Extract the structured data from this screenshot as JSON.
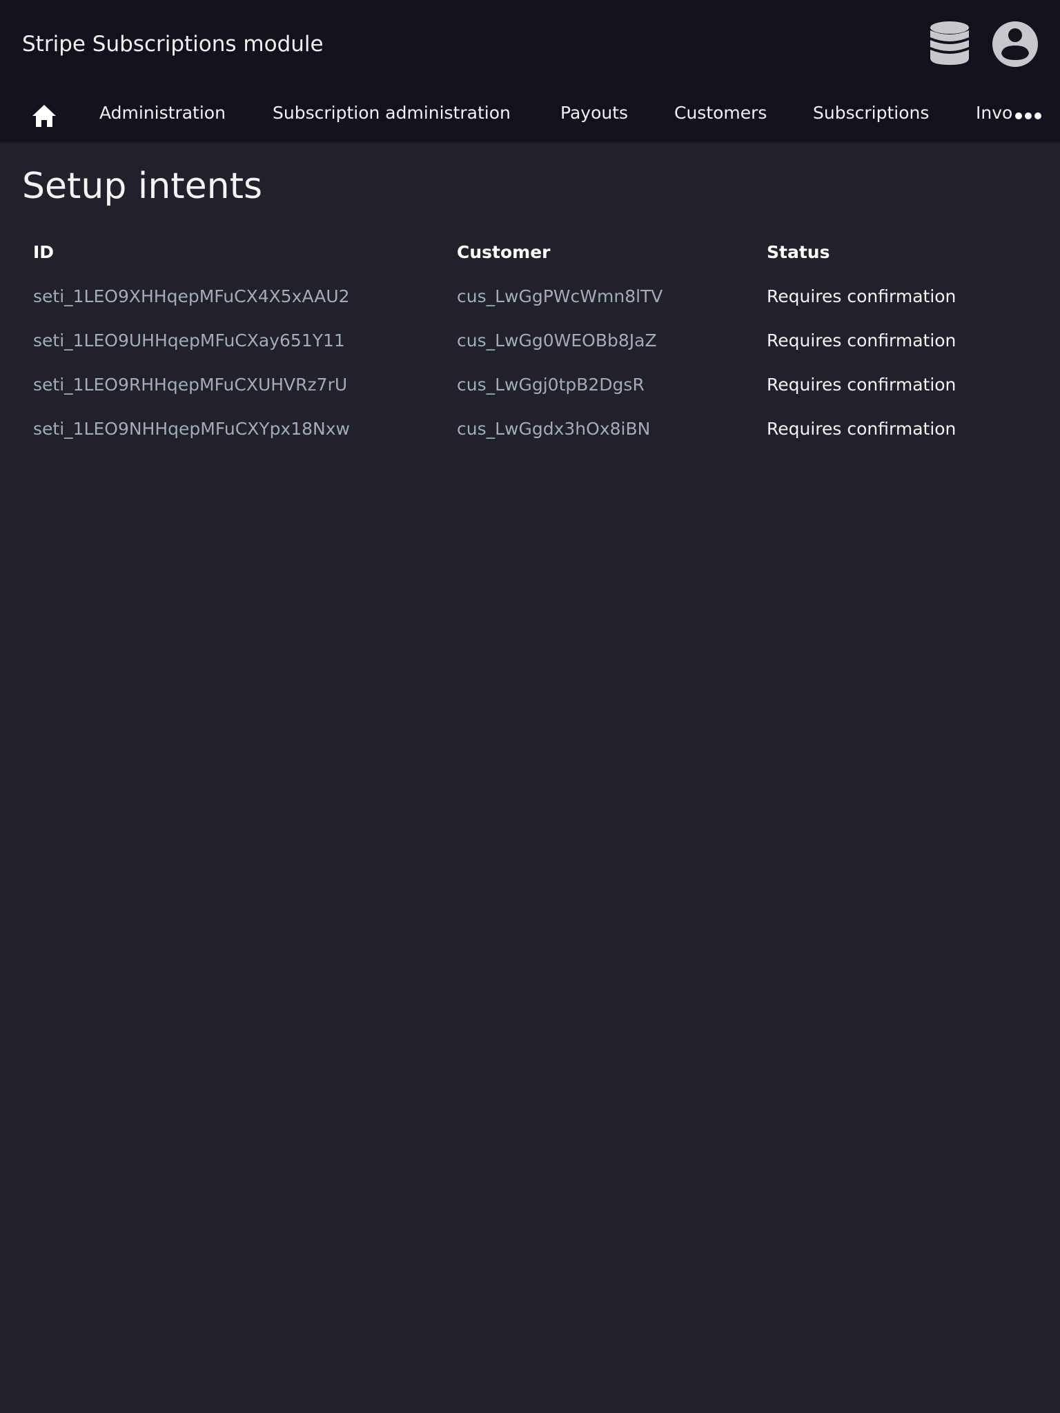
{
  "app": {
    "title": "Stripe Subscriptions module"
  },
  "header_icons": {
    "database": "database-icon",
    "user": "user-account-icon"
  },
  "nav": {
    "home_icon": "home-icon",
    "items": [
      {
        "label": "Administration"
      },
      {
        "label": "Subscription administration"
      },
      {
        "label": "Payouts"
      },
      {
        "label": "Customers"
      },
      {
        "label": "Subscriptions"
      },
      {
        "label": "Invoices"
      }
    ],
    "more_icon": "more-horizontal-icon"
  },
  "page": {
    "title": "Setup intents"
  },
  "table": {
    "columns": [
      "ID",
      "Customer",
      "Status"
    ],
    "rows": [
      {
        "id": "seti_1LEO9XHHqepMFuCX4X5xAAU2",
        "customer": "cus_LwGgPWcWmn8lTV",
        "status": "Requires confirmation"
      },
      {
        "id": "seti_1LEO9UHHqepMFuCXay651Y11",
        "customer": "cus_LwGg0WEOBb8JaZ",
        "status": "Requires confirmation"
      },
      {
        "id": "seti_1LEO9RHHqepMFuCXUHVRz7rU",
        "customer": "cus_LwGgj0tpB2DgsR",
        "status": "Requires confirmation"
      },
      {
        "id": "seti_1LEO9NHHqepMFuCXYpx18Nxw",
        "customer": "cus_LwGgdx3hOx8iBN",
        "status": "Requires confirmation"
      }
    ]
  },
  "colors": {
    "topbar_bg": "#12121c",
    "page_bg": "#21212b",
    "muted_text": "#a6a9b6",
    "icon_gray": "#c8c8cc"
  }
}
